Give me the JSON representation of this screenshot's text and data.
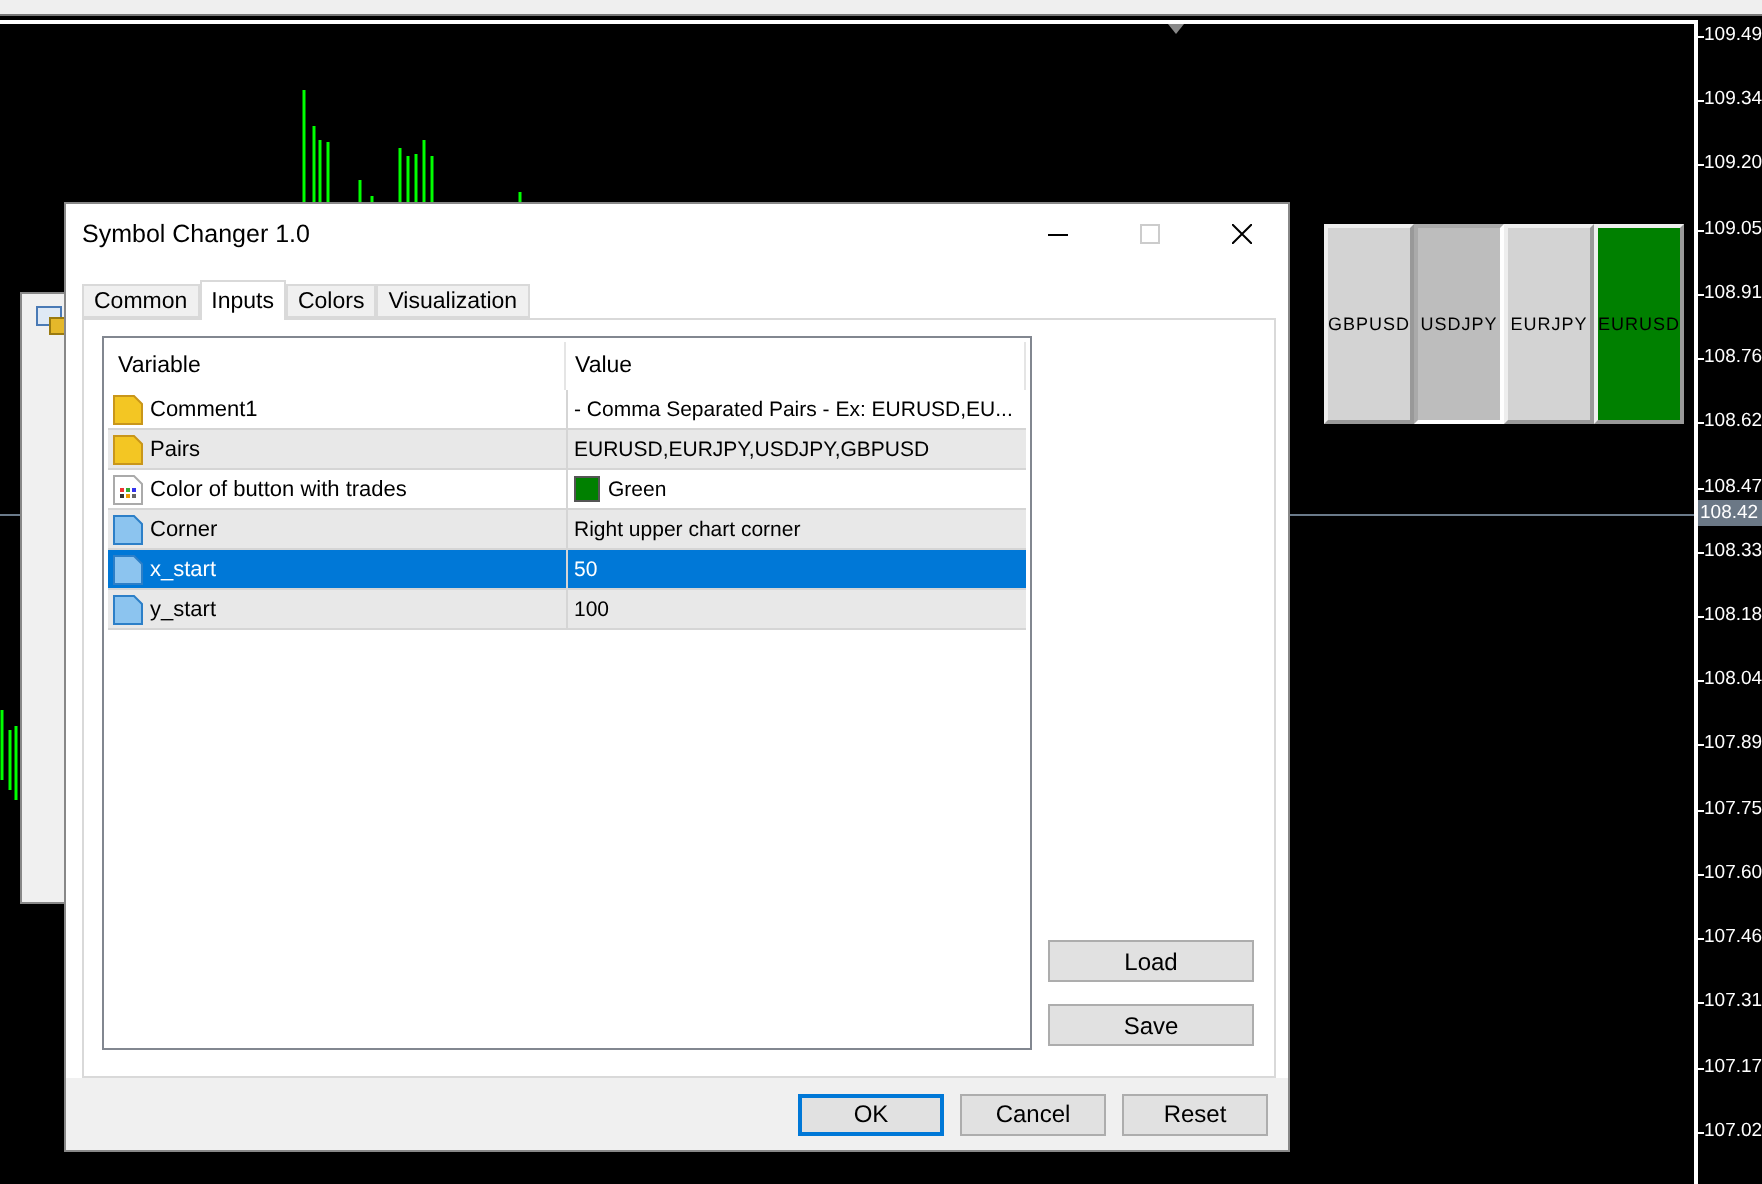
{
  "chart": {
    "price_labels": [
      "109.49",
      "109.34",
      "109.20",
      "109.05",
      "108.91",
      "108.76",
      "108.62",
      "108.47",
      "108.33",
      "108.18",
      "108.04",
      "107.89",
      "107.75",
      "107.60",
      "107.46",
      "107.31",
      "107.17",
      "107.02"
    ],
    "current_price": "108.42",
    "symbol_buttons": [
      {
        "label": "GBPUSD",
        "color": "#d3d3d3",
        "pressed": false
      },
      {
        "label": "USDJPY",
        "color": "#bdbdbd",
        "pressed": true
      },
      {
        "label": "EURJPY",
        "color": "#d3d3d3",
        "pressed": false
      },
      {
        "label": "EURUSD",
        "color": "#008000",
        "pressed": false
      }
    ]
  },
  "dialog": {
    "title": "Symbol Changer 1.0",
    "tabs": [
      {
        "label": "Common",
        "selected": false
      },
      {
        "label": "Inputs",
        "selected": true
      },
      {
        "label": "Colors",
        "selected": false
      },
      {
        "label": "Visualization",
        "selected": false
      }
    ],
    "table": {
      "columns": [
        "Variable",
        "Value"
      ],
      "rows": [
        {
          "kind": "string",
          "variable": "Comment1",
          "value": "- Comma Separated Pairs - Ex: EURUSD,EU...",
          "selected": false
        },
        {
          "kind": "string",
          "variable": "Pairs",
          "value": "EURUSD,EURJPY,USDJPY,GBPUSD",
          "selected": false
        },
        {
          "kind": "color",
          "variable": "Color of button with trades",
          "value": "Green",
          "color": "#008000",
          "selected": false
        },
        {
          "kind": "number",
          "variable": "Corner",
          "value": "Right upper chart corner",
          "selected": false
        },
        {
          "kind": "number",
          "variable": "x_start",
          "value": "50",
          "selected": true
        },
        {
          "kind": "number",
          "variable": "y_start",
          "value": "100",
          "selected": false
        }
      ]
    },
    "side_buttons": [
      "Load",
      "Save"
    ],
    "buttons": [
      {
        "label": "OK",
        "default": true
      },
      {
        "label": "Cancel",
        "default": false
      },
      {
        "label": "Reset",
        "default": false
      }
    ]
  }
}
